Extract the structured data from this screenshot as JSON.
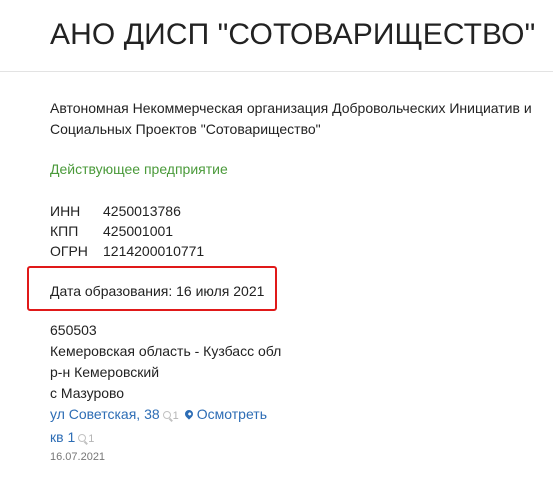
{
  "header": {
    "title": "АНО ДИСП \"СОТОВАРИЩЕСТВО\""
  },
  "company": {
    "full_name": "Автономная Некоммерческая организация Добровольческих Инициатив и Социальных Проектов \"Сотоварищество\"",
    "status": "Действующее предприятие",
    "codes": [
      {
        "label": "ИНН",
        "value": "4250013786"
      },
      {
        "label": "КПП",
        "value": "425001001"
      },
      {
        "label": "ОГРН",
        "value": "1214200010771"
      }
    ],
    "registration": "Дата образования: 16 июля 2021",
    "highlight_color": "#e01919",
    "status_color": "#4a9a3a",
    "link_color": "#2d6db5"
  },
  "address": {
    "postcode": "650503",
    "region": "Кемеровская область - Кузбасс обл",
    "district": "р-н Кемеровский",
    "locality": "с Мазурово",
    "street": "ул Советская, 38",
    "street_count": "1",
    "map_link": "Осмотреть",
    "apartment": "кв 1",
    "apartment_count": "1",
    "icons": {
      "count": "search-icon",
      "map": "map-pin-icon"
    }
  },
  "footer": {
    "updated": "16.07.2021"
  }
}
